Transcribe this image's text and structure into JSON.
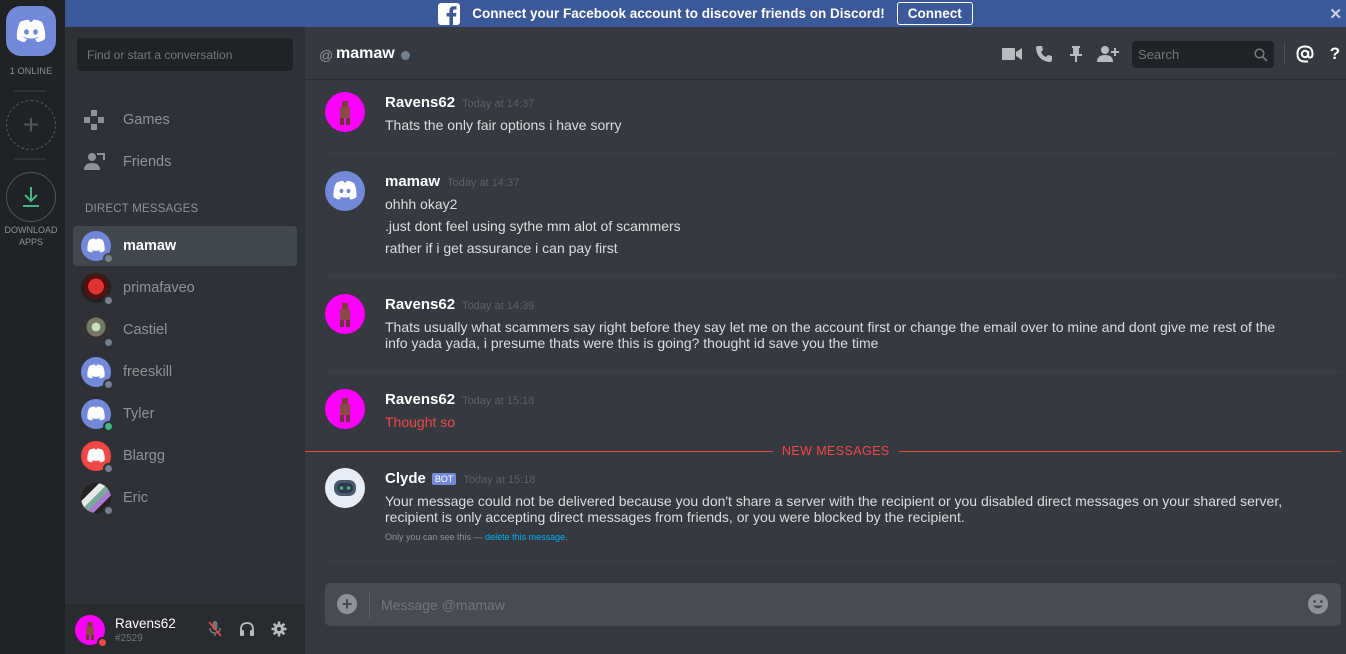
{
  "banner": {
    "text": "Connect your Facebook account to discover friends on Discord!",
    "connect_label": "Connect",
    "close_glyph": "✕"
  },
  "guilds": {
    "online_count": "1 ONLINE",
    "download_label": "DOWNLOAD APPS"
  },
  "sidebar": {
    "search_placeholder": "Find or start a conversation",
    "nav": [
      {
        "label": "Games",
        "icon": "gamepad-icon"
      },
      {
        "label": "Friends",
        "icon": "friends-icon"
      }
    ],
    "dm_header": "DIRECT MESSAGES",
    "dms": [
      {
        "name": "mamaw",
        "avatar": "discord-blue",
        "status": "offline",
        "active": true
      },
      {
        "name": "primafaveo",
        "avatar": "photo-red",
        "status": "offline"
      },
      {
        "name": "Castiel",
        "avatar": "photo-dark",
        "status": "offline"
      },
      {
        "name": "freeskill",
        "avatar": "discord-blue",
        "status": "offline"
      },
      {
        "name": "Tyler",
        "avatar": "discord-blue",
        "status": "online"
      },
      {
        "name": "Blargg",
        "avatar": "discord-red",
        "status": "offline"
      },
      {
        "name": "Eric",
        "avatar": "photo-rainbow",
        "status": "offline"
      }
    ]
  },
  "user_panel": {
    "username": "Ravens62",
    "discriminator": "#2529"
  },
  "chat": {
    "at_symbol": "@",
    "channel_name": "mamaw",
    "search_placeholder": "Search",
    "new_messages_label": "NEW MESSAGES",
    "composer_placeholder": "Message @mamaw",
    "messages": [
      {
        "author": "Ravens62",
        "time": "Today at 14:37",
        "lines": [
          "Thats the only fair options i have sorry"
        ]
      },
      {
        "author": "mamaw",
        "time": "Today at 14:37",
        "lines": [
          "ohhh okay2",
          ".just dont feel using sythe mm alot of scammers",
          "rather if i get assurance i can pay first"
        ]
      },
      {
        "author": "Ravens62",
        "time": "Today at 14:39",
        "lines": [
          "Thats usually what scammers say right before they say let me on the account first or change the email over to mine and dont give me rest of the",
          "info yada yada, i presume thats were this is going? thought id save you the time"
        ]
      },
      {
        "author": "Ravens62",
        "time": "Today at 15:18",
        "lines": [
          "Thought so"
        ]
      },
      {
        "author": "Clyde",
        "bot_tag": "BOT",
        "time": "Today at 15:18",
        "lines": [
          "Your message could not be delivered because you don't share a server with the recipient or you disabled direct messages on your shared server,",
          "recipient is only accepting direct messages from friends, or you were blocked by the recipient."
        ],
        "ephemeral_note": "Only you can see this —",
        "ephemeral_link": "delete this message."
      }
    ]
  },
  "colors": {
    "brand": "#7289da",
    "magenta_avatar": "#ff00ff",
    "error_text": "#f04747",
    "online": "#43b581",
    "offline": "#747f8d",
    "facebook": "#3b5998"
  }
}
